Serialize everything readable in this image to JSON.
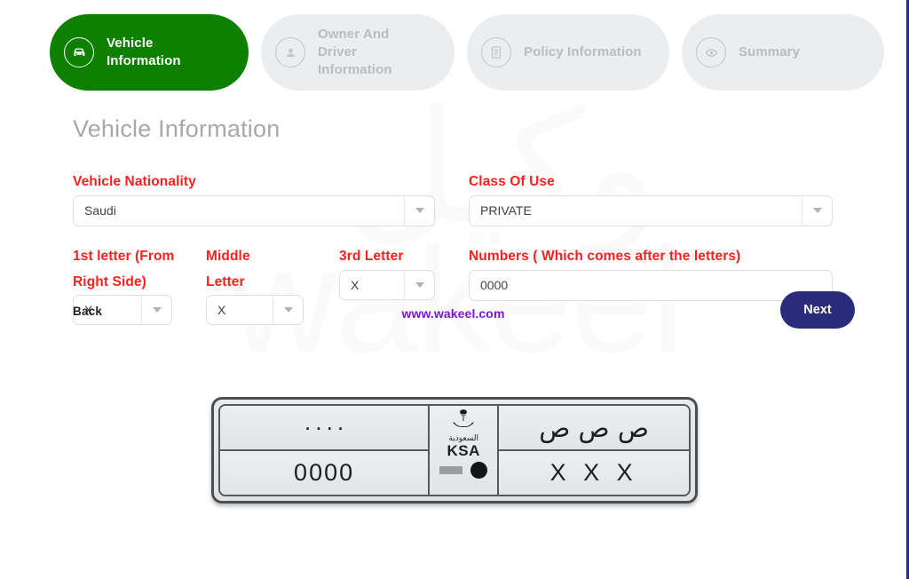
{
  "stepper": {
    "steps": [
      {
        "label": "Vehicle\nInformation",
        "icon": "car-icon",
        "state": "active"
      },
      {
        "label": "Owner And Driver\nInformation",
        "icon": "user-icon",
        "state": "inactive"
      },
      {
        "label": "Policy Information",
        "icon": "book-icon",
        "state": "inactive"
      },
      {
        "label": "Summary",
        "icon": "eye-icon",
        "state": "inactive"
      }
    ]
  },
  "heading": "Vehicle Information",
  "form": {
    "vehicle_nationality": {
      "label": "Vehicle Nationality",
      "value": "Saudi"
    },
    "class_of_use": {
      "label": "Class Of Use",
      "value": "PRIVATE"
    },
    "first_letter": {
      "label": "1st letter (From Right Side)",
      "value": "X"
    },
    "middle_letter": {
      "label": "Middle Letter",
      "value": "X"
    },
    "third_letter": {
      "label": "3rd Letter",
      "value": "X"
    },
    "numbers": {
      "label": "Numbers ( Which comes after the letters)",
      "value": "0000"
    }
  },
  "plate": {
    "arabic_digits": "٠٠٠٠",
    "latin_digits": "0000",
    "arabic_letters": "ص ص ص",
    "latin_letters": "X X X",
    "emblem_arabic": "السعودية",
    "emblem_latin": "KSA"
  },
  "footer": {
    "back_label": "Back",
    "site_url": "www.wakeel.com",
    "next_label": "Next"
  },
  "watermark": {
    "arabic": "وكيل",
    "latin": "wakeel"
  },
  "colors": {
    "active_step": "#0d8000",
    "inactive_step": "#ebedee",
    "label_red": "#ff1f1f",
    "next_button": "#2b2b7c",
    "url_purple": "#7b16e0"
  }
}
